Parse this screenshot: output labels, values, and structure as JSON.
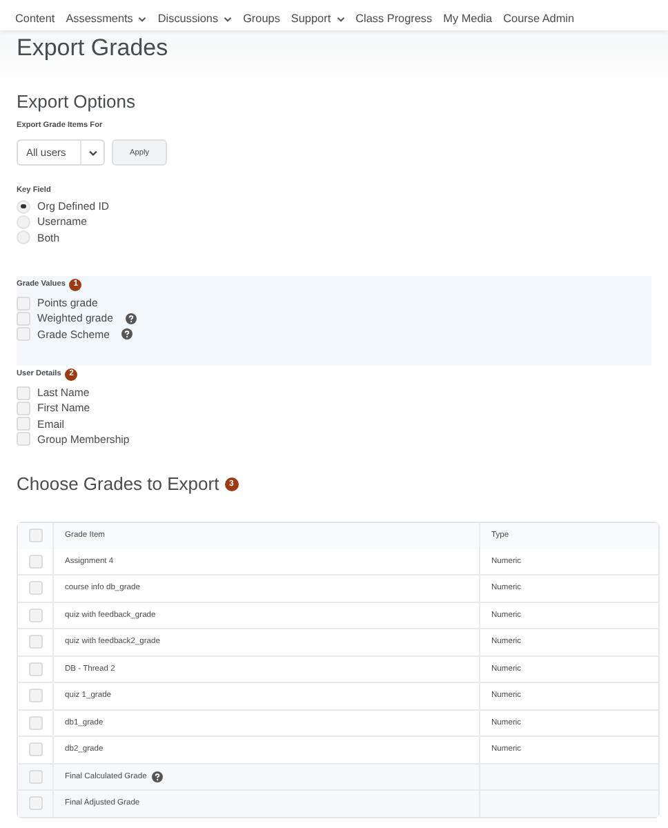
{
  "nav": [
    {
      "label": "Content",
      "dropdown": false
    },
    {
      "label": "Assessments",
      "dropdown": true
    },
    {
      "label": "Discussions",
      "dropdown": true
    },
    {
      "label": "Groups",
      "dropdown": false
    },
    {
      "label": "Support",
      "dropdown": true
    },
    {
      "label": "Class Progress",
      "dropdown": false
    },
    {
      "label": "My Media",
      "dropdown": false
    },
    {
      "label": "Course Admin",
      "dropdown": false
    }
  ],
  "page_title": "Export Grades",
  "export_options": {
    "heading": "Export Options",
    "items_for_label": "Export Grade Items For",
    "select_value": "All users",
    "apply_button": "Apply"
  },
  "key_field": {
    "label": "Key Field",
    "options": [
      {
        "label": "Org Defined ID",
        "selected": true
      },
      {
        "label": "Username",
        "selected": false
      },
      {
        "label": "Both",
        "selected": false
      }
    ]
  },
  "grade_values": {
    "label": "Grade Values",
    "badge": "1",
    "options": [
      {
        "label": "Points grade",
        "checked": false,
        "help": false
      },
      {
        "label": "Weighted grade",
        "checked": false,
        "help": true
      },
      {
        "label": "Grade Scheme",
        "checked": false,
        "help": true
      }
    ]
  },
  "user_details": {
    "label": "User Details",
    "badge": "2",
    "options": [
      {
        "label": "Last Name",
        "checked": false
      },
      {
        "label": "First Name",
        "checked": false
      },
      {
        "label": "Email",
        "checked": false
      },
      {
        "label": "Group Membership",
        "checked": false
      }
    ]
  },
  "choose_grades": {
    "heading": "Choose Grades to Export",
    "badge": "3"
  },
  "table": {
    "columns": [
      "Grade Item",
      "Type"
    ],
    "all_checked": false,
    "rows": [
      {
        "kind": "item",
        "name": "Assignment 4",
        "type": "Numeric",
        "checked": false,
        "help": false
      },
      {
        "kind": "item",
        "name": "course info db_grade",
        "type": "Numeric",
        "checked": false,
        "help": false
      },
      {
        "kind": "item",
        "name": "quiz with feedback_grade",
        "type": "Numeric",
        "checked": false,
        "help": false
      },
      {
        "kind": "item",
        "name": "quiz with feedback2_grade",
        "type": "Numeric",
        "checked": false,
        "help": false
      },
      {
        "kind": "item",
        "name": "DB - Thread 2",
        "type": "Numeric",
        "checked": false,
        "help": false
      },
      {
        "kind": "item",
        "name": "quiz 1_grade",
        "type": "Numeric",
        "checked": false,
        "help": false
      },
      {
        "kind": "item",
        "name": "db1_grade",
        "type": "Numeric",
        "checked": false,
        "help": false
      },
      {
        "kind": "item",
        "name": "db2_grade",
        "type": "Numeric",
        "checked": false,
        "help": false
      },
      {
        "kind": "final",
        "name": "Final Calculated Grade",
        "checked": false,
        "help": true
      },
      {
        "kind": "final",
        "name": "Final Adjusted Grade",
        "checked": false,
        "help": false
      }
    ]
  }
}
